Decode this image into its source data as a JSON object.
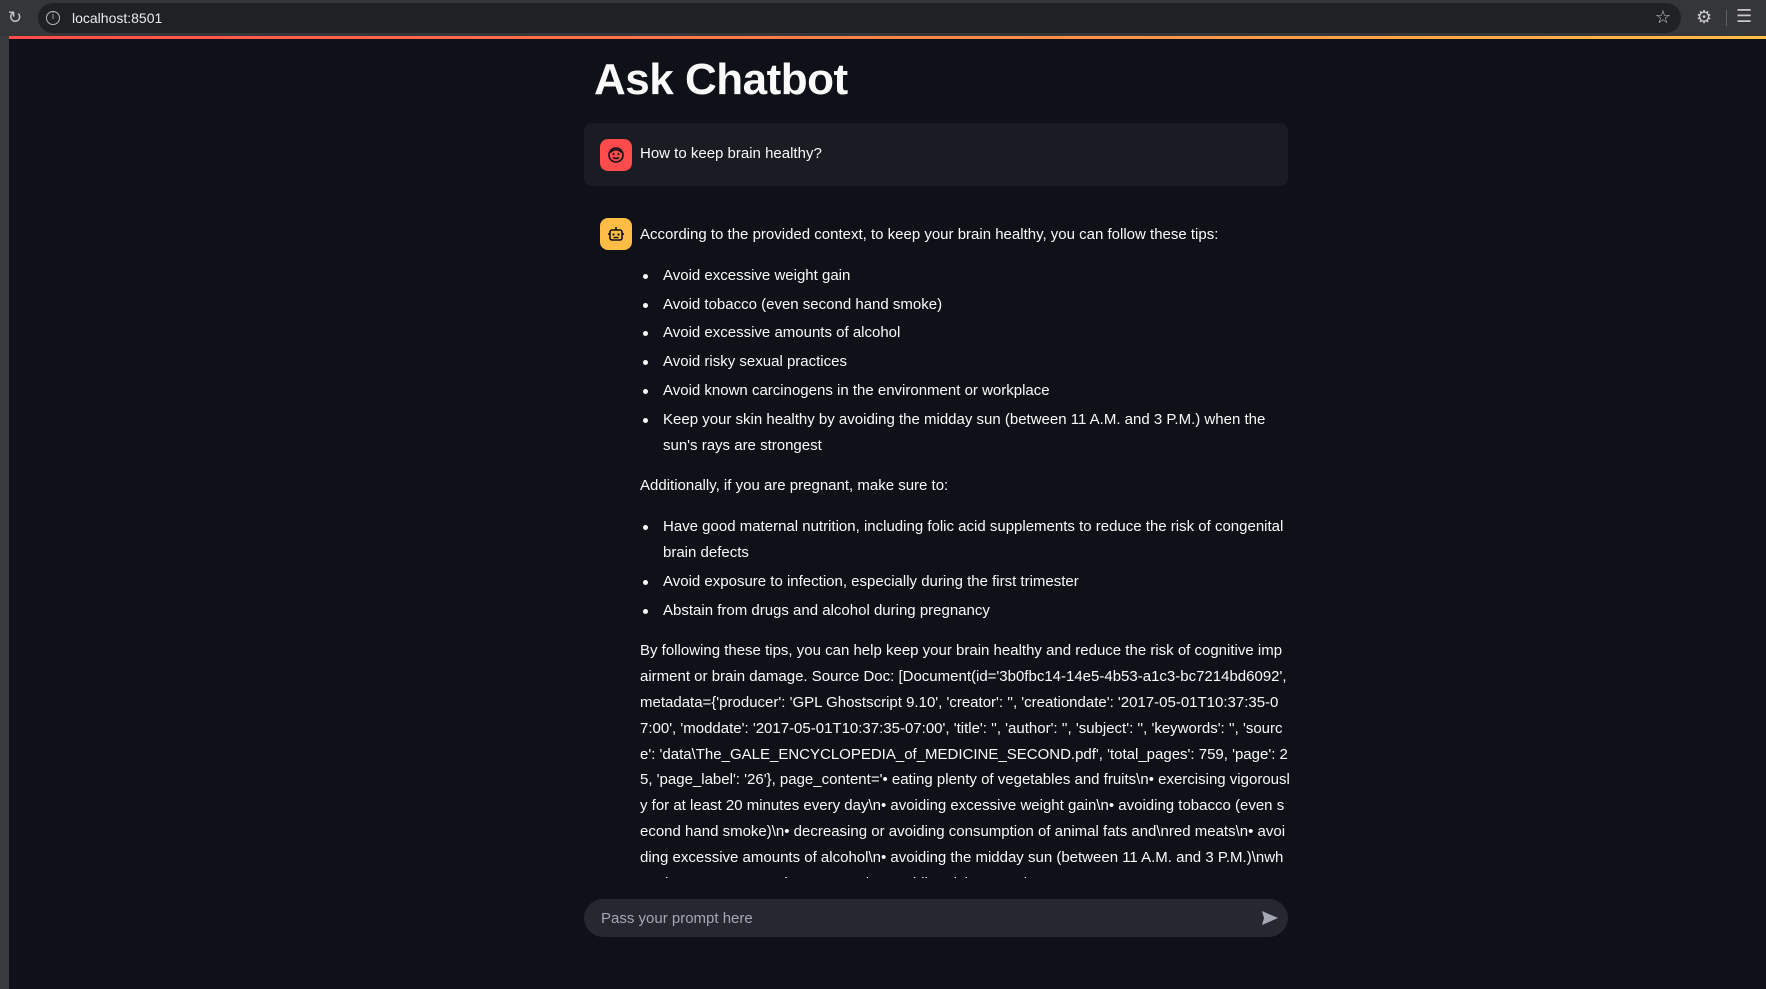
{
  "browser": {
    "url": "localhost:8501"
  },
  "app": {
    "title": "Ask Chatbot"
  },
  "messages": {
    "user": {
      "avatar_icon": "user-face-icon",
      "text": "How to keep brain healthy?"
    },
    "assistant": {
      "avatar_icon": "robot-icon",
      "intro": "According to the provided context, to keep your brain healthy, you can follow these tips:",
      "tips": [
        "Avoid excessive weight gain",
        "Avoid tobacco (even second hand smoke)",
        "Avoid excessive amounts of alcohol",
        "Avoid risky sexual practices",
        "Avoid known carcinogens in the environment or workplace",
        "Keep your skin healthy by avoiding the midday sun (between 11 A.M. and 3 P.M.) when the sun's rays are strongest"
      ],
      "pregnancy_intro": "Additionally, if you are pregnant, make sure to:",
      "pregnancy_tips": [
        "Have good maternal nutrition, including folic acid supplements to reduce the risk of congenital brain defects",
        "Avoid exposure to infection, especially during the first trimester",
        "Abstain from drugs and alcohol during pregnancy"
      ],
      "conclusion": "By following these tips, you can help keep your brain healthy and reduce the risk of cognitive impairment or brain damage. Source Doc: [Document(id='3b0fbc14-14e5-4b53-a1c3-bc7214bd6092', metadata={'producer': 'GPL Ghostscript 9.10', 'creator': '', 'creationdate': '2017-05-01T10:37:35-07:00', 'moddate': '2017-05-01T10:37:35-07:00', 'title': '', 'author': '', 'subject': '', 'keywords': '', 'source': 'data\\The_GALE_ENCYCLOPEDIA_of_MEDICINE_SECOND.pdf', 'total_pages': 759, 'page': 25, 'page_label': '26'}, page_content='• eating plenty of vegetables and fruits\\n• exercising vigorously for at least 20 minutes every day\\n• avoiding excessive weight gain\\n• avoiding tobacco (even second hand smoke)\\n• decreasing or avoiding consumption of animal fats and\\nred meats\\n• avoiding excessive amounts of alcohol\\n• avoiding the midday sun (between 11 A.M. and 3 P.M.)\\nwhen the suns rays are the strongest\\n• avoiding risky sexual"
    }
  },
  "chat_input": {
    "placeholder": "Pass your prompt here"
  },
  "colors": {
    "background": "#0e1117",
    "user_message_bg": "#1a1c24",
    "user_avatar": "#ff4b4b",
    "assistant_avatar": "#ffbd45",
    "input_bg": "#262730"
  }
}
